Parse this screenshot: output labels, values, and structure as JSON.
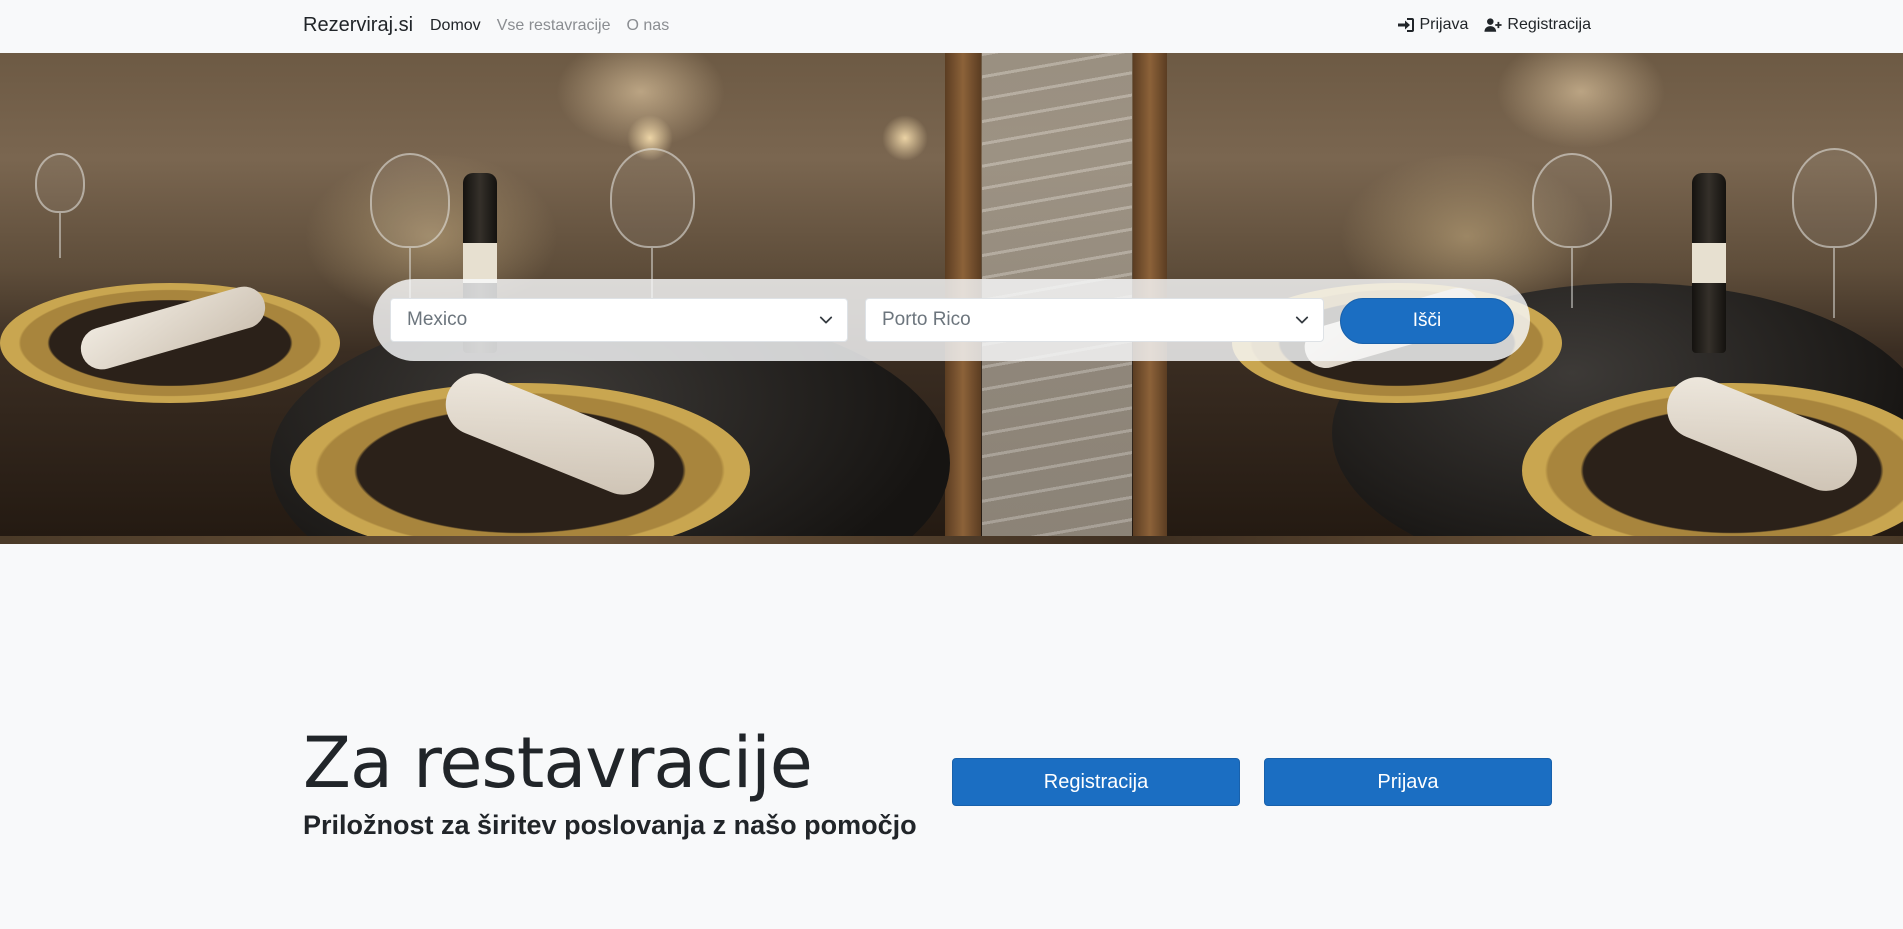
{
  "navbar": {
    "brand": "Rezerviraj.si",
    "links": [
      {
        "label": "Domov"
      },
      {
        "label": "Vse restavracije"
      },
      {
        "label": "O nas"
      }
    ],
    "login_label": "Prijava",
    "register_label": "Registracija",
    "icons": [
      "sign-in-icon",
      "user-plus-icon"
    ]
  },
  "search": {
    "country_value": "Mexico",
    "city_value": "Porto Rico",
    "button_label": "Išči",
    "accent_color": "#1b6ec2"
  },
  "cta": {
    "title": "Za restavracije",
    "subtitle": "Priložnost za širitev poslovanja z našo pomočjo",
    "register_label": "Registracija",
    "login_label": "Prijava"
  }
}
